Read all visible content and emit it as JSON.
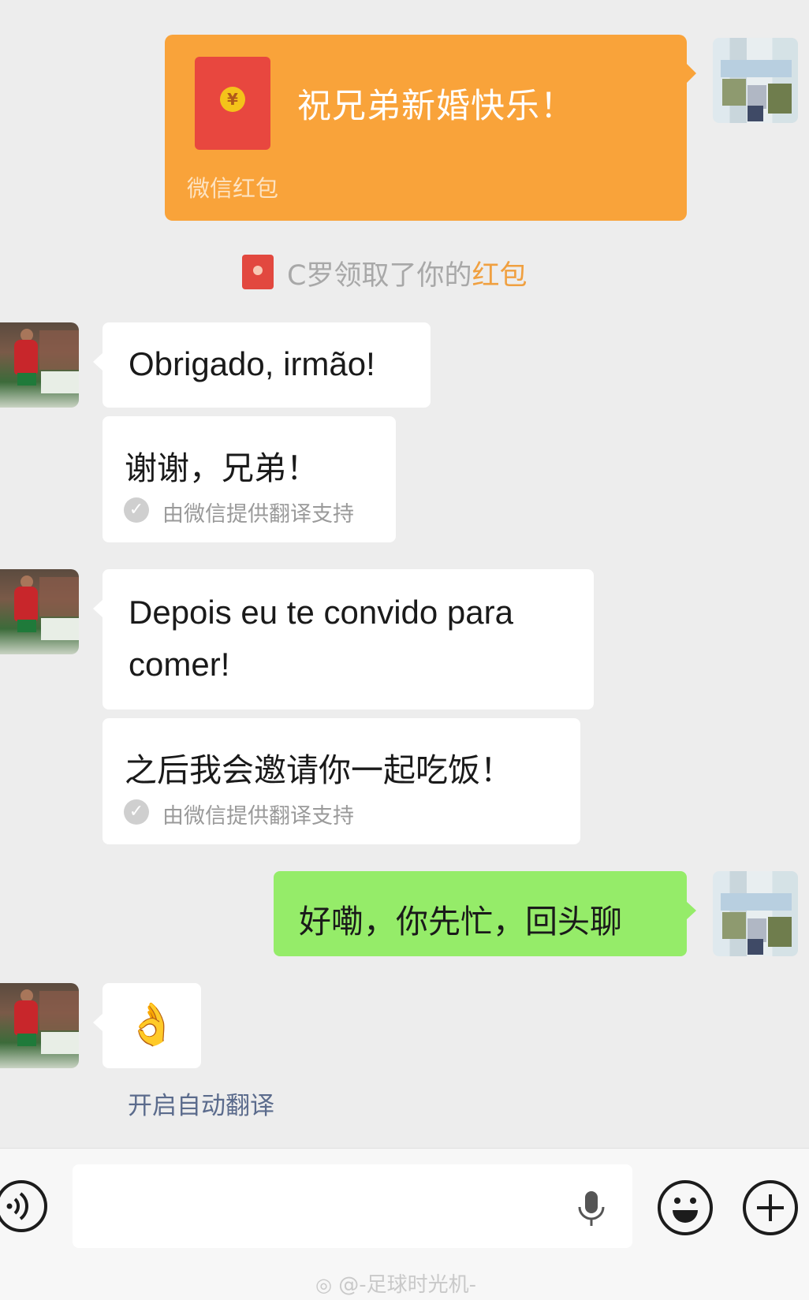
{
  "red_packet": {
    "greeting": "祝兄弟新婚快乐！",
    "label": "微信红包",
    "coin_symbol": "¥",
    "color": "#f9a33a"
  },
  "system_notice": {
    "prefix": "C罗领取了你的",
    "highlight": "红包",
    "highlight_color": "#f0a040"
  },
  "messages": [
    {
      "text": "Obrigado, irmão!"
    },
    {
      "translation": "谢谢，兄弟！",
      "note": "由微信提供翻译支持"
    },
    {
      "text_line1": "Depois eu te convido para",
      "text_line2": "comer!"
    },
    {
      "translation": "之后我会邀请你一起吃饭！",
      "note": "由微信提供翻译支持"
    },
    {
      "text": "好嘞，你先忙，回头聊",
      "color": "#95ec69"
    },
    {
      "emoji": "👌"
    }
  ],
  "auto_translate_link": "开启自动翻译",
  "bottom_bar": {
    "voice_icon": "voice-icon",
    "mic_icon": "microphone-icon",
    "emoji_icon": "emoji-icon",
    "plus_icon": "plus-icon"
  },
  "watermark": "@-足球时光机-"
}
